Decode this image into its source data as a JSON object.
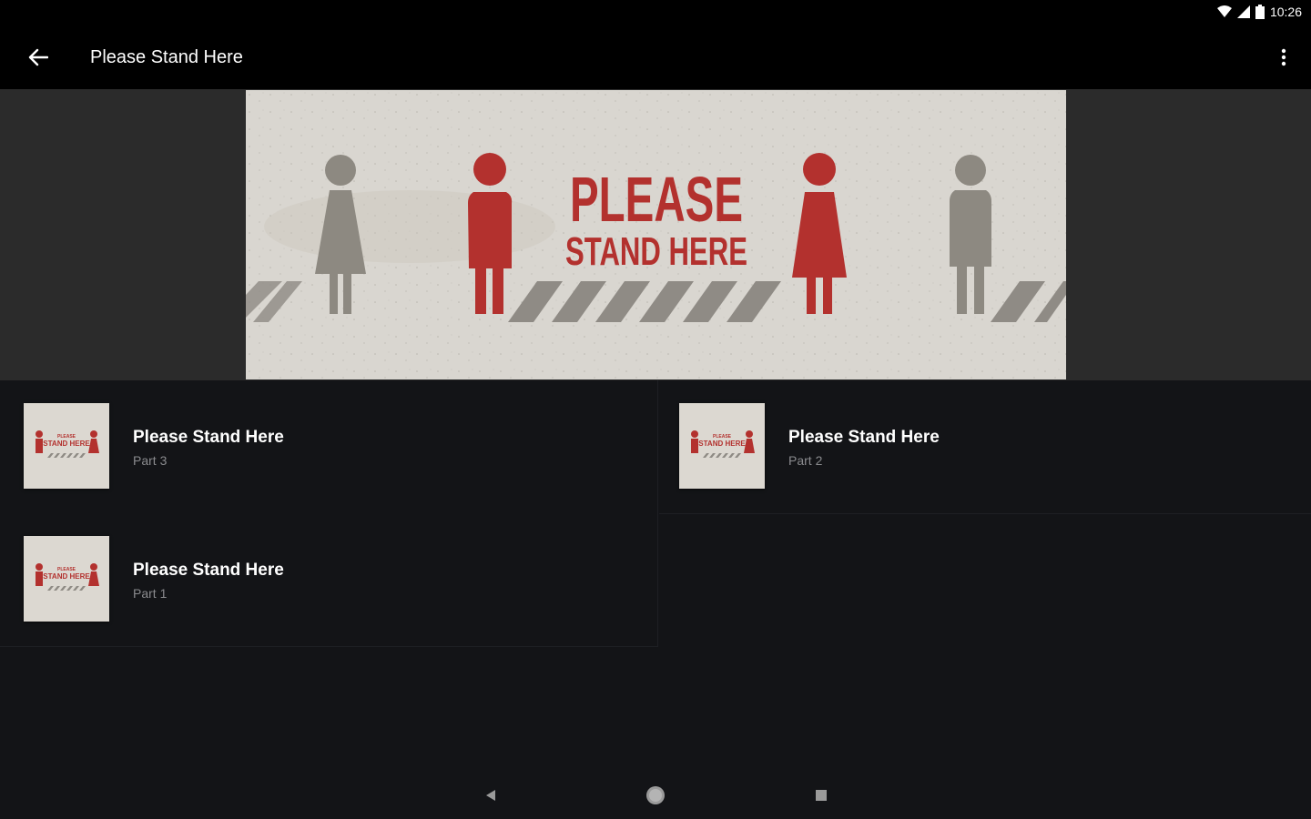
{
  "status_bar": {
    "time": "10:26",
    "icons": [
      "wifi-icon",
      "signal-icon",
      "battery-icon"
    ]
  },
  "app_bar": {
    "title": "Please Stand Here",
    "back_icon": "arrow-back-icon",
    "menu_icon": "more-vert-icon"
  },
  "hero": {
    "line1": "PLEASE",
    "line2": "STAND HERE"
  },
  "thumbnail_text": {
    "line1": "PLEASE",
    "line2": "STAND HERE"
  },
  "episodes": [
    {
      "title": "Please Stand Here",
      "subtitle": "Part 3"
    },
    {
      "title": "Please Stand Here",
      "subtitle": "Part 2"
    },
    {
      "title": "Please Stand Here",
      "subtitle": "Part 1"
    }
  ],
  "nav_bar": {
    "icons": [
      "back-triangle-icon",
      "home-circle-icon",
      "recents-square-icon"
    ]
  },
  "colors": {
    "accent_red": "#b3312e",
    "background": "#131417",
    "app_bar": "#000000",
    "hero_bg": "#2b2b2b"
  }
}
